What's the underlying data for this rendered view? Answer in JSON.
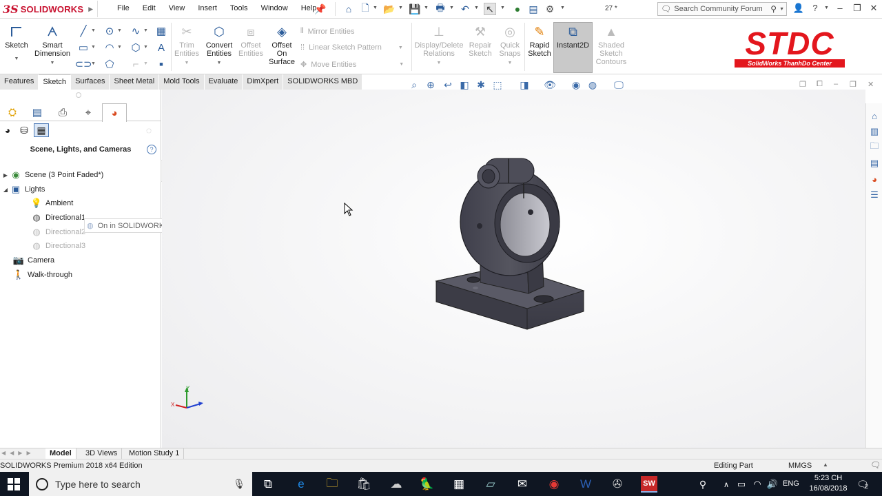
{
  "app": {
    "logo_ds": "3S",
    "logo_text": "SOLIDWORKS",
    "menu": [
      "File",
      "Edit",
      "View",
      "Insert",
      "Tools",
      "Window",
      "Help"
    ],
    "rebuild_value": "27 *",
    "search_placeholder": "Search Community Forum"
  },
  "ribbon": {
    "sketch": "Sketch",
    "smart_dimension": [
      "Smart",
      "Dimension"
    ],
    "trim_entities": [
      "Trim",
      "Entities"
    ],
    "convert_entities": [
      "Convert",
      "Entities"
    ],
    "offset_entities": [
      "Offset",
      "Entities"
    ],
    "offset_on_surface": [
      "Offset",
      "On",
      "Surface"
    ],
    "mirror_entities": "Mirror Entities",
    "linear_sketch_pattern": "Linear Sketch Pattern",
    "move_entities": "Move Entities",
    "display_delete_relations": [
      "Display/Delete",
      "Relations"
    ],
    "repair_sketch": [
      "Repair",
      "Sketch"
    ],
    "quick_snaps": [
      "Quick",
      "Snaps"
    ],
    "rapid_sketch": [
      "Rapid",
      "Sketch"
    ],
    "instant2d": "Instant2D",
    "shaded_sketch_contours": [
      "Shaded",
      "Sketch",
      "Contours"
    ]
  },
  "watermark": {
    "title": "STDC",
    "subtitle": "SolidWorks ThanhDo Center"
  },
  "tabs": [
    "Features",
    "Sketch",
    "Surfaces",
    "Sheet Metal",
    "Mold Tools",
    "Evaluate",
    "DimXpert",
    "SOLIDWORKS MBD"
  ],
  "active_tab": "Sketch",
  "panel": {
    "title": "Scene, Lights, and Cameras",
    "help": "?",
    "tree": [
      {
        "label": "Scene (3 Point Faded*)",
        "icon": "scene-icon"
      },
      {
        "label": "Lights",
        "icon": "lights-folder-icon"
      },
      {
        "label": "Ambient",
        "icon": "ambient-light-icon"
      },
      {
        "label": "Directional1",
        "icon": "directional-light-icon"
      },
      {
        "label": "Directional2",
        "icon": "directional-light-icon"
      },
      {
        "label": "Directional3",
        "icon": "directional-light-icon"
      },
      {
        "label": "Camera",
        "icon": "camera-icon"
      },
      {
        "label": "Walk-through",
        "icon": "walk-through-icon"
      }
    ],
    "tooltip": "On in SOLIDWORKS"
  },
  "triad": {
    "x": "X",
    "y": "Y"
  },
  "bottom_tabs": [
    "Model",
    "3D Views",
    "Motion Study 1"
  ],
  "status": {
    "edition": "SOLIDWORKS Premium 2018 x64 Edition",
    "mode": "Editing Part",
    "units": "MMGS"
  },
  "taskbar": {
    "search_placeholder": "Type here to search",
    "language": "ENG",
    "time": "5:23 CH",
    "date": "16/08/2018",
    "notifications": "2"
  }
}
